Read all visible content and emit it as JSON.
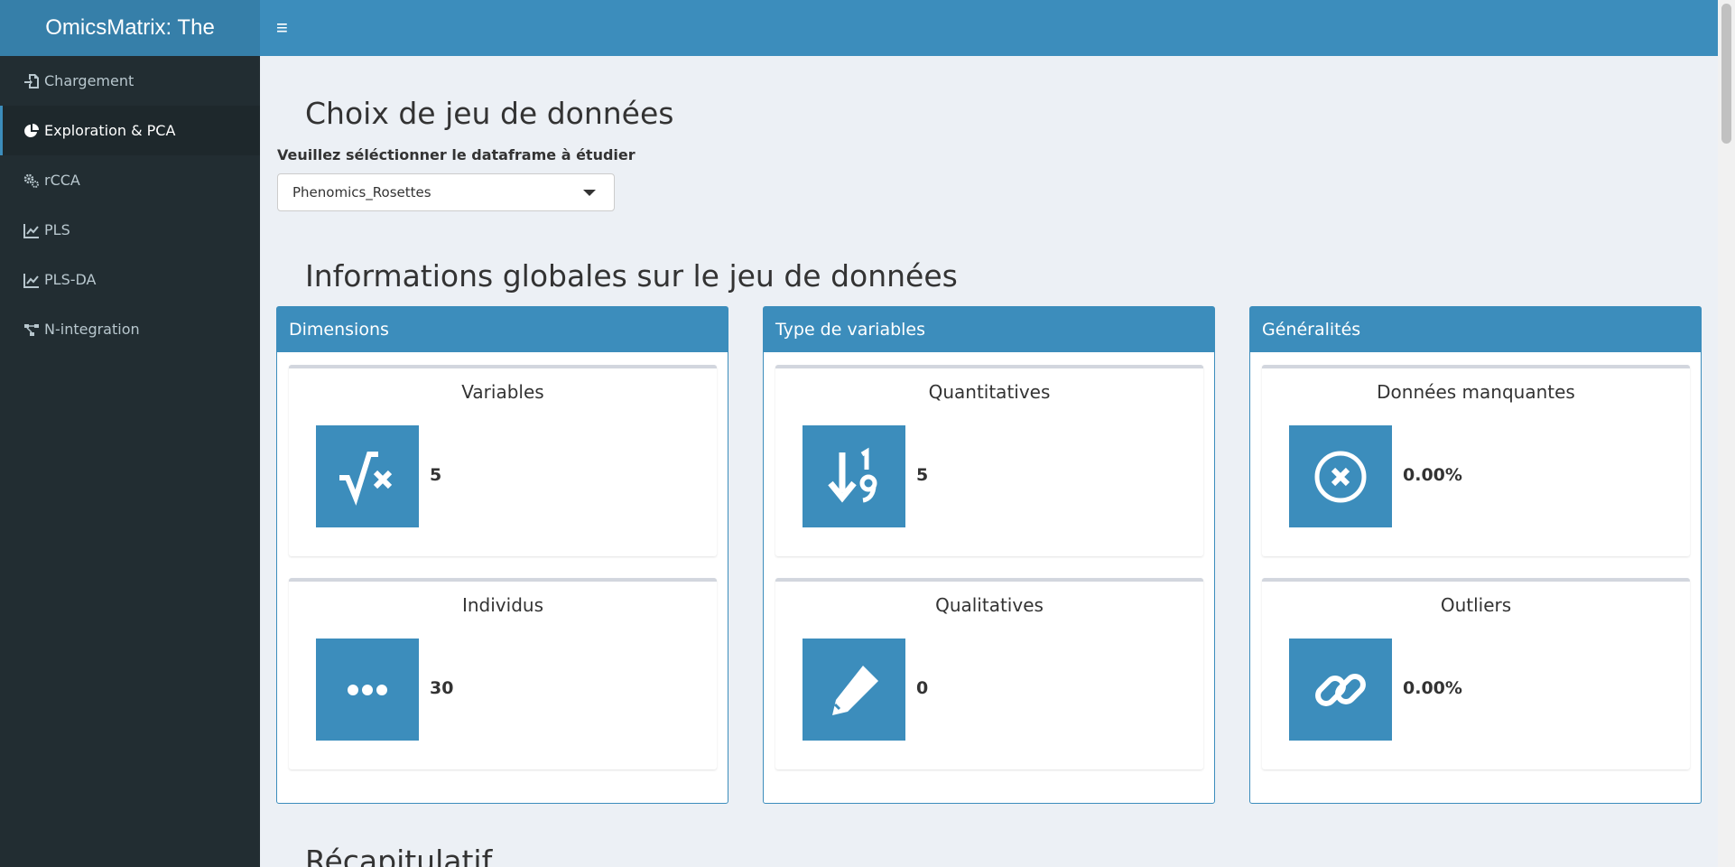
{
  "app": {
    "title": "OmicsMatrix: The"
  },
  "header": {
    "toggle_glyph": "≡"
  },
  "sidebar": {
    "items": [
      {
        "label": "Chargement",
        "icon": "file-import-icon",
        "active": false
      },
      {
        "label": "Exploration & PCA",
        "icon": "pie-chart-icon",
        "active": true
      },
      {
        "label": "rCCA",
        "icon": "gears-icon",
        "active": false
      },
      {
        "label": "PLS",
        "icon": "line-chart-icon",
        "active": false
      },
      {
        "label": "PLS-DA",
        "icon": "line-chart-icon",
        "active": false
      },
      {
        "label": "N-integration",
        "icon": "project-diagram-icon",
        "active": false
      }
    ]
  },
  "main": {
    "section1_title": "Choix de jeu de données",
    "select_label": "Veuillez séléctionner le dataframe à étudier",
    "select_value": "Phenomics_Rosettes",
    "section2_title": "Informations globales sur le jeu de données",
    "section3_title": "Récapitulatif",
    "boxes": [
      {
        "title": "Dimensions",
        "items": [
          {
            "title": "Variables",
            "value": "5",
            "icon": "square-root-icon"
          },
          {
            "title": "Individus",
            "value": "30",
            "icon": "ellipsis-icon"
          }
        ]
      },
      {
        "title": "Type de variables",
        "items": [
          {
            "title": "Quantitatives",
            "value": "5",
            "icon": "sort-numeric-down-icon"
          },
          {
            "title": "Qualitatives",
            "value": "0",
            "icon": "pen-icon"
          }
        ]
      },
      {
        "title": "Généralités",
        "items": [
          {
            "title": "Données manquantes",
            "value": "0.00%",
            "icon": "times-circle-icon"
          },
          {
            "title": "Outliers",
            "value": "0.00%",
            "icon": "link-icon"
          }
        ]
      }
    ]
  },
  "colors": {
    "primary": "#3c8dbc",
    "logo": "#367fa9",
    "sidebar": "#222d32",
    "background": "#ecf0f5"
  }
}
